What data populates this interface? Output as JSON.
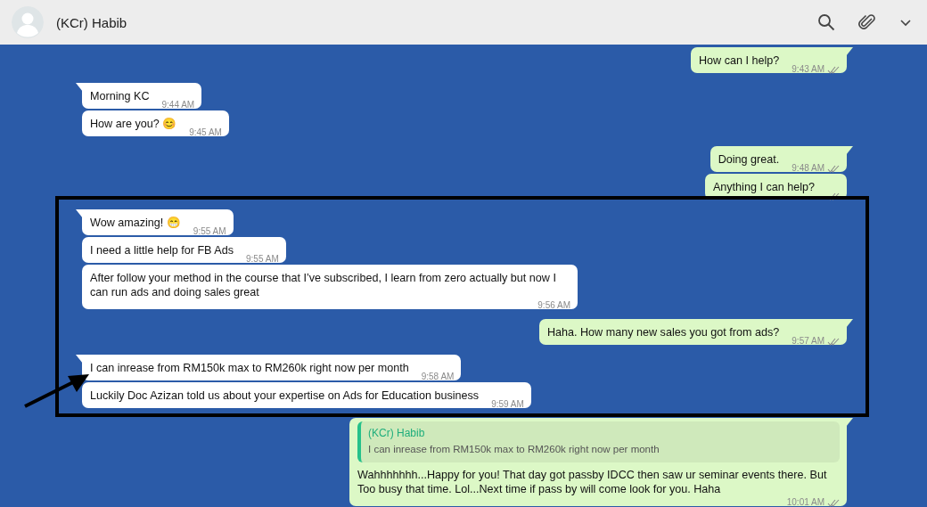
{
  "header": {
    "contact_name": "(KCr) Habib"
  },
  "groups": [
    {
      "kind": "outgoing",
      "messages": [
        {
          "text": "How can I help?",
          "time": "9:43 AM",
          "read": true
        }
      ]
    },
    {
      "kind": "incoming",
      "messages": [
        {
          "text": "Morning KC",
          "time": "9:44 AM"
        },
        {
          "text": "How are you? 😊",
          "time": "9:45 AM"
        }
      ]
    },
    {
      "kind": "outgoing",
      "messages": [
        {
          "text": "Doing great.",
          "time": "9:48 AM",
          "read": true
        },
        {
          "text": "Anything I can help?",
          "read": true
        }
      ]
    },
    {
      "kind": "incoming",
      "messages": [
        {
          "text": "Wow amazing! 😁",
          "time": "9:55 AM"
        },
        {
          "text": "I need a little help for FB Ads",
          "time": "9:55 AM"
        },
        {
          "text": "After follow your method in the course that I’ve subscribed, I learn from zero actually but now I can run ads and doing sales great",
          "time": "9:56 AM"
        }
      ]
    },
    {
      "kind": "outgoing",
      "messages": [
        {
          "text": "Haha. How many new sales you got from ads?",
          "time": "9:57 AM",
          "read": true
        }
      ]
    },
    {
      "kind": "incoming",
      "messages": [
        {
          "text": "I can inrease from RM150k max to RM260k right now per month",
          "time": "9:58 AM"
        },
        {
          "text": "Luckily Doc Azizan told us about your expertise on Ads for Education business",
          "time": "9:59 AM"
        }
      ]
    },
    {
      "kind": "outgoing",
      "messages": [
        {
          "quote": {
            "author": "(KCr) Habib",
            "text": "I can inrease from RM150k max to RM260k right now per month"
          },
          "text": "Wahhhhhhh...Happy for you! That day got passby IDCC then saw ur seminar events there. But Too busy that time. Lol...Next time if pass by will come look for you. Haha",
          "time": "10:01 AM",
          "read": true
        }
      ]
    }
  ]
}
